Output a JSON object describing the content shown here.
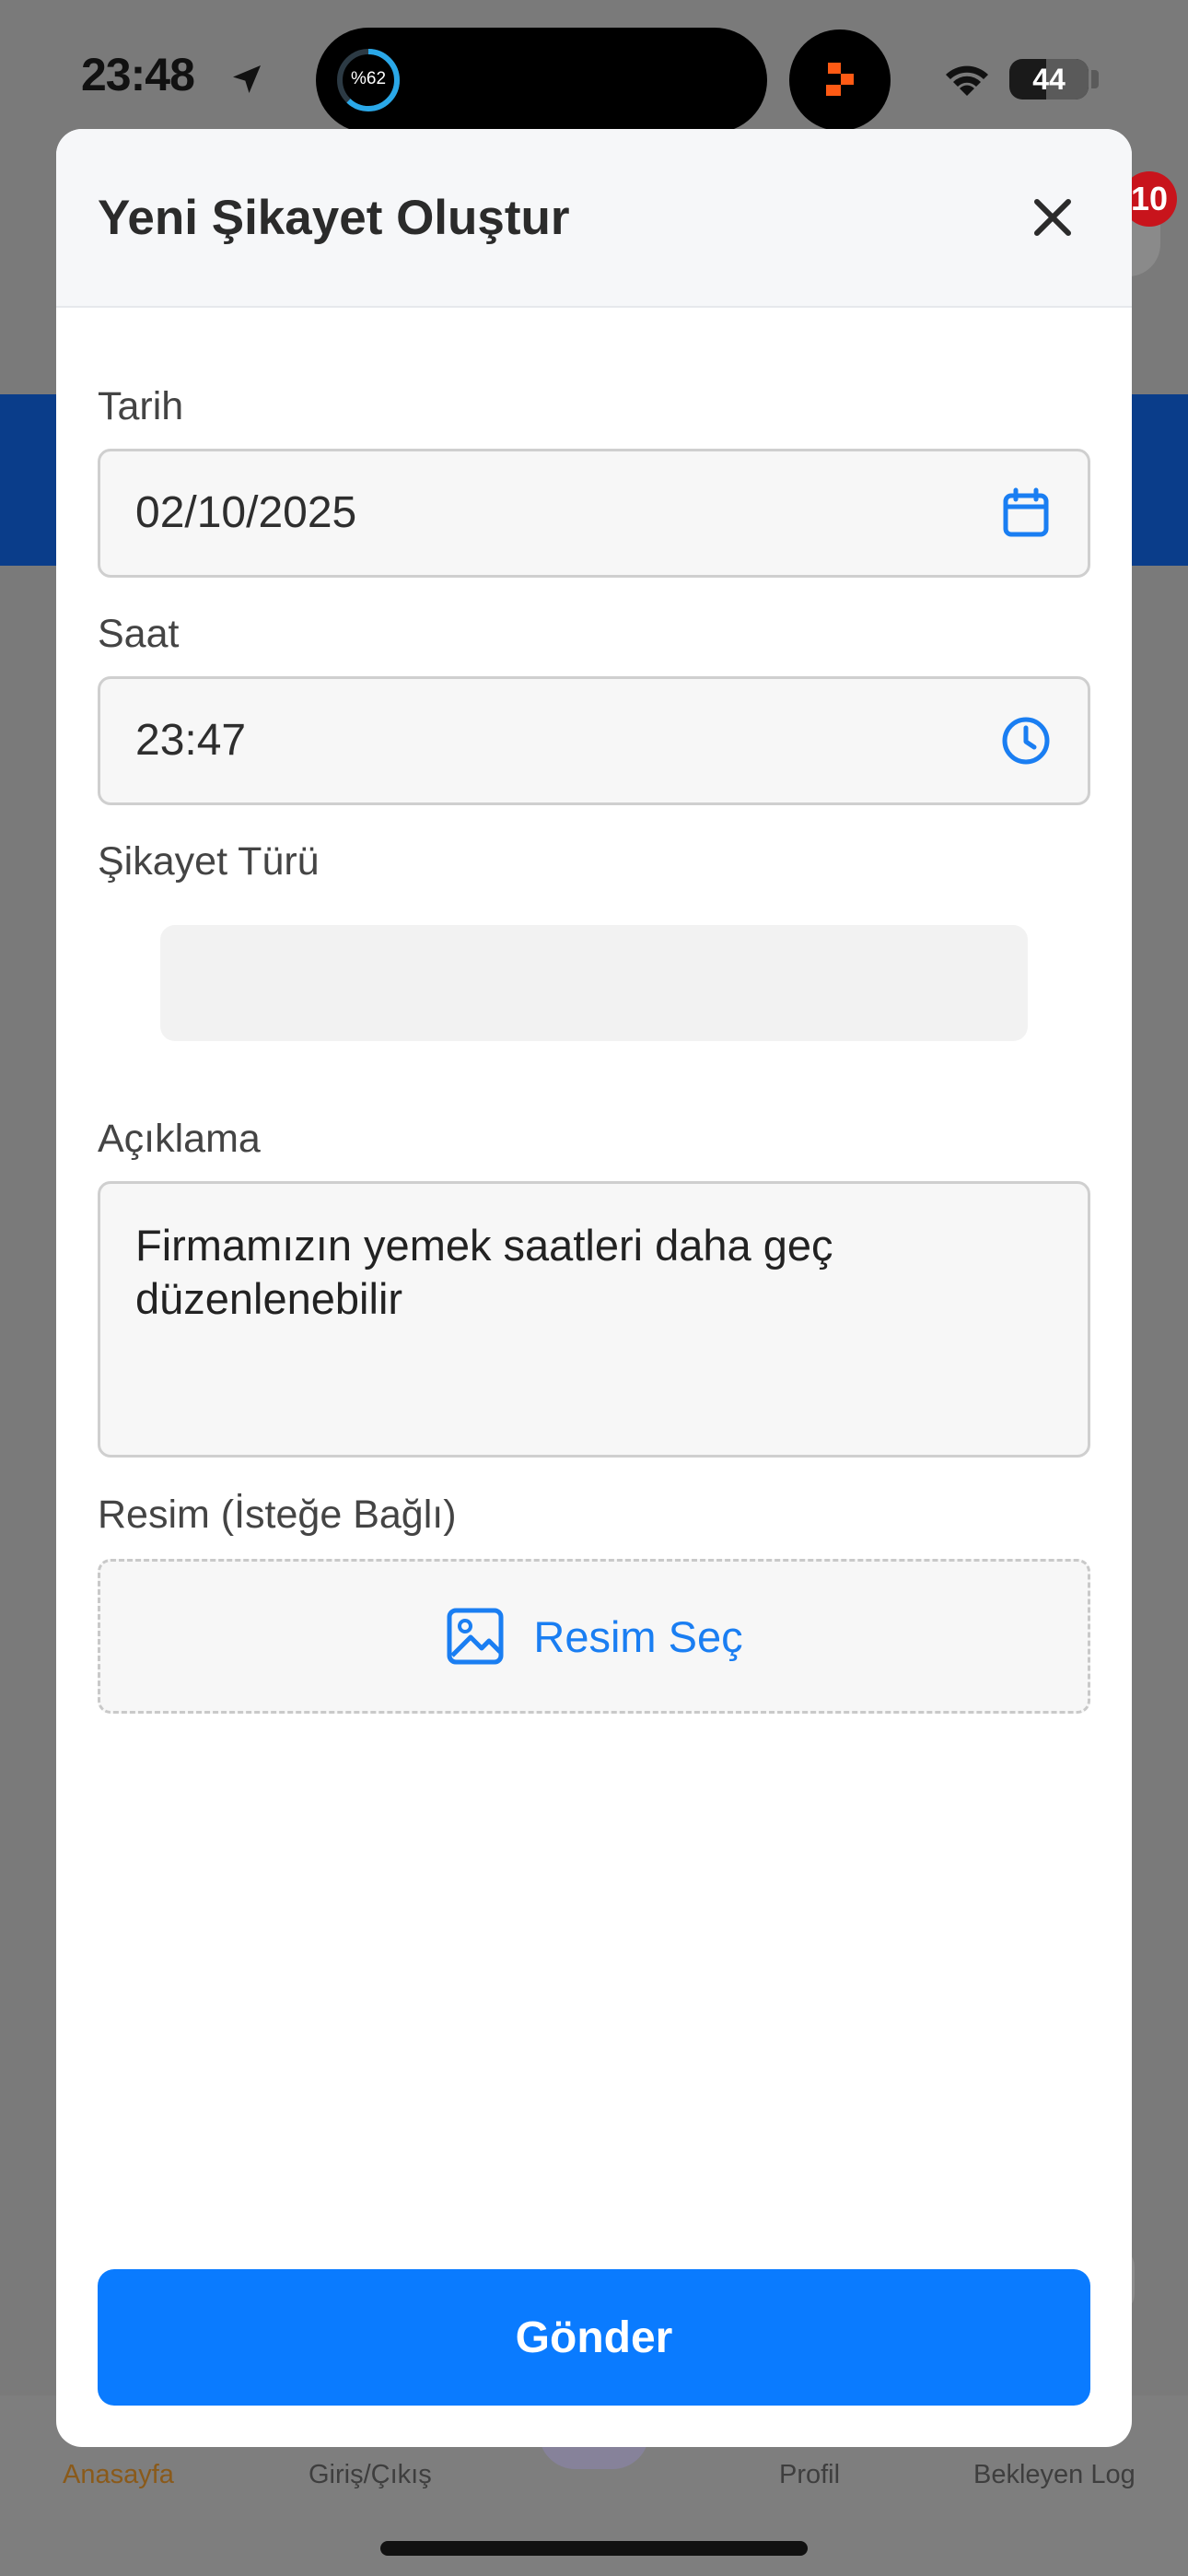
{
  "status_bar": {
    "time": "23:48",
    "activity_percent": "%62",
    "battery": "44"
  },
  "background": {
    "badge_count": "10",
    "tabs": [
      {
        "label": "Anasayfa",
        "active": true
      },
      {
        "label": "Giriş/Çıkış",
        "active": false
      },
      {
        "label": "Profil",
        "active": false
      },
      {
        "label": "Bekleyen Log",
        "active": false
      }
    ]
  },
  "modal": {
    "title": "Yeni Şikayet Oluştur",
    "date": {
      "label": "Tarih",
      "value": "02/10/2025",
      "icon": "calendar-icon"
    },
    "time": {
      "label": "Saat",
      "value": "23:47",
      "icon": "clock-icon"
    },
    "complaint_type": {
      "label": "Şikayet Türü",
      "value": ""
    },
    "description": {
      "label": "Açıklama",
      "value": "Firmamızın yemek saatleri daha geç düzenlenebilir"
    },
    "image": {
      "label": "Resim (İsteğe Bağlı)",
      "button_label": "Resim Seç",
      "icon": "image-icon"
    },
    "submit_label": "Gönder"
  },
  "colors": {
    "accent": "#0a7bff",
    "overlay": "#7a7a7a",
    "active_tab": "#8a5a1a"
  }
}
